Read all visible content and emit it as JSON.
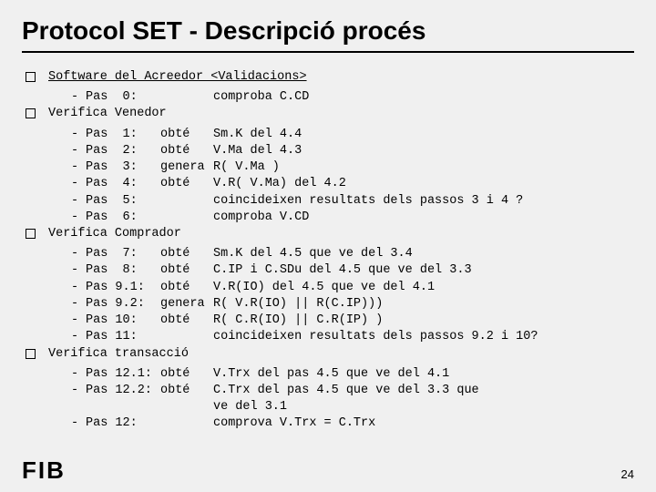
{
  "title": "Protocol SET - Descripció procés",
  "subtitle": "Software del Acreedor <Validacions>",
  "sections": [
    {
      "head": "",
      "items": [
        {
          "pas": "Pas  0:",
          "act": "",
          "desc": "comproba C.CD"
        }
      ]
    },
    {
      "head": "Verifica Venedor",
      "items": [
        {
          "pas": "Pas  1:",
          "act": "obté",
          "desc": "Sm.K del 4.4"
        },
        {
          "pas": "Pas  2:",
          "act": "obté",
          "desc": "V.Ma del 4.3"
        },
        {
          "pas": "Pas  3:",
          "act": "genera",
          "desc": "R( V.Ma )"
        },
        {
          "pas": "Pas  4:",
          "act": "obté",
          "desc": "V.R( V.Ma) del 4.2"
        },
        {
          "pas": "Pas  5:",
          "act": "",
          "desc": "coincideixen resultats dels passos 3 i 4 ?"
        },
        {
          "pas": "Pas  6:",
          "act": "",
          "desc": "comproba V.CD"
        }
      ]
    },
    {
      "head": "Verifica Comprador",
      "items": [
        {
          "pas": "Pas  7:",
          "act": "obté",
          "desc": "Sm.K del 4.5 que ve del 3.4"
        },
        {
          "pas": "Pas  8:",
          "act": "obté",
          "desc": "C.IP i C.SDu del 4.5 que ve del 3.3"
        },
        {
          "pas": "Pas 9.1:",
          "act": "obté",
          "desc": "V.R(IO) del 4.5 que ve del 4.1"
        },
        {
          "pas": "Pas 9.2:",
          "act": "genera",
          "desc": "R( V.R(IO) || R(C.IP)))"
        },
        {
          "pas": "Pas 10:",
          "act": "obté",
          "desc": "R( C.R(IO) || C.R(IP) )"
        },
        {
          "pas": "Pas 11:",
          "act": "",
          "desc": "coincideixen resultats dels passos 9.2 i 10?"
        }
      ]
    },
    {
      "head": "Verifica transacció",
      "items": [
        {
          "pas": "Pas 12.1:",
          "act": "obté",
          "desc": "V.Trx del pas 4.5 que ve del 4.1"
        },
        {
          "pas": "Pas 12.2:",
          "act": "obté",
          "desc": "C.Trx del pas 4.5 que ve del 3.3 que"
        },
        {
          "pas": "",
          "act": "",
          "desc": "ve del 3.1",
          "nodash": true
        },
        {
          "pas": "Pas 12:",
          "act": "",
          "desc": "comprova V.Trx = C.Trx"
        }
      ]
    }
  ],
  "footer": "FIB",
  "page_number": "24"
}
